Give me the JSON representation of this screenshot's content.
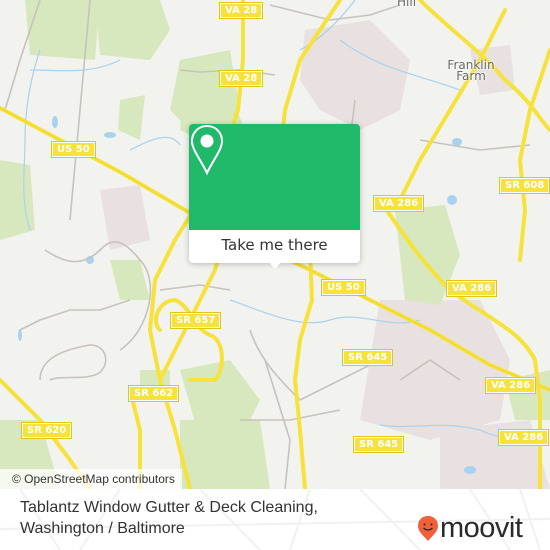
{
  "map": {
    "road_shields": [
      {
        "label": "VA 28"
      },
      {
        "label": "VA 28"
      },
      {
        "label": "US 50"
      },
      {
        "label": "US 50"
      },
      {
        "label": "VA 286"
      },
      {
        "label": "VA 286"
      },
      {
        "label": "VA 286"
      },
      {
        "label": "VA 286"
      },
      {
        "label": "SR 608"
      },
      {
        "label": "SR 657"
      },
      {
        "label": "SR 645"
      },
      {
        "label": "SR 645"
      },
      {
        "label": "SR 662"
      },
      {
        "label": "SR 620"
      }
    ],
    "places": [
      {
        "label": "Hill"
      },
      {
        "label": "Franklin\nFarm"
      }
    ],
    "colors": {
      "background": "#f2f2ef",
      "park": "#d8e8be",
      "water": "#a8d2f0",
      "major_road": "#f6e23a",
      "minor_road": "#c7c2bd",
      "urban": "#e8e1e0"
    },
    "attribution": "© OpenStreetMap contributors"
  },
  "popup": {
    "button_label": "Take me there",
    "accent_color": "#1fb969",
    "icon": "map-pin-icon"
  },
  "footer": {
    "title_line1": "Tablantz Window Gutter & Deck Cleaning,",
    "title_line2": "Washington / Baltimore",
    "brand": "moovit",
    "brand_color": "#f0603a"
  }
}
